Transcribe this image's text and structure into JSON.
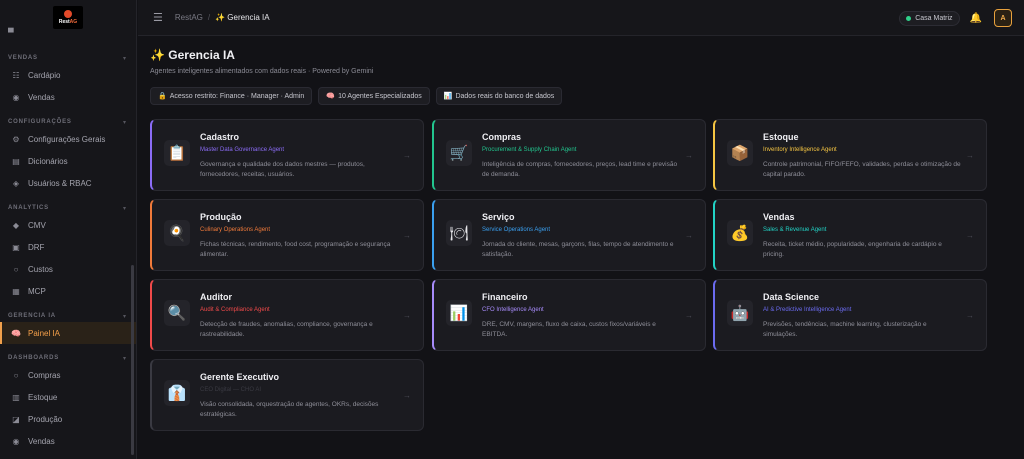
{
  "app": {
    "logo_text_main": "Rest",
    "logo_text_accent": "AG"
  },
  "sidebar": {
    "sections": [
      {
        "label": "VENDAS",
        "items": [
          {
            "label": "Cardápio",
            "icon": "menu-list-icon"
          },
          {
            "label": "Vendas",
            "icon": "target-icon"
          }
        ]
      },
      {
        "label": "CONFIGURAÇÕES",
        "items": [
          {
            "label": "Configurações Gerais",
            "icon": "gear-icon"
          },
          {
            "label": "Dicionários",
            "icon": "book-icon"
          },
          {
            "label": "Usuários & RBAC",
            "icon": "shield-icon"
          }
        ]
      },
      {
        "label": "ANALYTICS",
        "items": [
          {
            "label": "CMV",
            "icon": "diamond-icon"
          },
          {
            "label": "DRF",
            "icon": "doc-icon"
          },
          {
            "label": "Custos",
            "icon": "circle-icon"
          },
          {
            "label": "MCP",
            "icon": "grid-icon"
          }
        ]
      },
      {
        "label": "GERENCIA IA",
        "items": [
          {
            "label": "Painel IA",
            "icon": "brain-icon",
            "active": true
          }
        ]
      },
      {
        "label": "DASHBOARDS",
        "items": [
          {
            "label": "Compras",
            "icon": "circle-icon"
          },
          {
            "label": "Estoque",
            "icon": "box-icon"
          },
          {
            "label": "Produção",
            "icon": "chef-icon"
          },
          {
            "label": "Vendas",
            "icon": "target-icon"
          }
        ]
      }
    ]
  },
  "topbar": {
    "breadcrumb_root": "RestAG",
    "breadcrumb_current": "✨ Gerencia IA",
    "location": "Casa Matriz",
    "avatar_initial": "A"
  },
  "page": {
    "title": "✨ Gerencia IA",
    "subtitle": "Agentes inteligentes alimentados com dados reais · Powered by Gemini",
    "chips": [
      {
        "icon": "🔒",
        "label": "Acesso restrito: Finance · Manager · Admin"
      },
      {
        "icon": "🧠",
        "label": "10 Agentes Especializados"
      },
      {
        "icon": "📊",
        "label": "Dados reais do banco de dados"
      }
    ]
  },
  "cards": [
    {
      "title": "Cadastro",
      "agent": "Master Data Governance Agent",
      "desc": "Governança e qualidade dos dados mestres — produtos, fornecedores, receitas, usuários.",
      "emoji": "📋",
      "color": "#8b6cf6"
    },
    {
      "title": "Compras",
      "agent": "Procurement & Supply Chain Agent",
      "desc": "Inteligência de compras, fornecedores, preços, lead time e previsão de demanda.",
      "emoji": "🛒",
      "color": "#22c58e"
    },
    {
      "title": "Estoque",
      "agent": "Inventory Intelligence Agent",
      "desc": "Controle patrimonial, FIFO/FEFO, validades, perdas e otimização de capital parado.",
      "emoji": "📦",
      "color": "#f5c542"
    },
    {
      "title": "Produção",
      "agent": "Culinary Operations Agent",
      "desc": "Fichas técnicas, rendimento, food cost, programação e segurança alimentar.",
      "emoji": "🍳",
      "color": "#f07a3a"
    },
    {
      "title": "Serviço",
      "agent": "Service Operations Agent",
      "desc": "Jornada do cliente, mesas, garçons, filas, tempo de atendimento e satisfação.",
      "emoji": "🍽",
      "color": "#3aa0f0"
    },
    {
      "title": "Vendas",
      "agent": "Sales & Revenue Agent",
      "desc": "Receita, ticket médio, popularidade, engenharia de cardápio e pricing.",
      "emoji": "💰",
      "color": "#22d3c5"
    },
    {
      "title": "Auditor",
      "agent": "Audit & Compliance Agent",
      "desc": "Detecção de fraudes, anomalias, compliance, governança e rastreabilidade.",
      "emoji": "🔍",
      "color": "#f04a4a"
    },
    {
      "title": "Financeiro",
      "agent": "CFO Intelligence Agent",
      "desc": "DRE, CMV, margens, fluxo de caixa, custos fixos/variáveis e EBITDA.",
      "emoji": "📊",
      "color": "#a78bfa"
    },
    {
      "title": "Data Science",
      "agent": "AI & Predictive Intelligence Agent",
      "desc": "Previsões, tendências, machine learning, clusterização e simulações.",
      "emoji": "🤖",
      "color": "#6b6bf0"
    },
    {
      "title": "Gerente Executivo",
      "agent": "CEO Digital — CHO AI",
      "desc": "Visão consolidada, orquestração de agentes, OKRs, decisões estratégicas.",
      "emoji": "👔",
      "color": "#3a3a42"
    }
  ]
}
